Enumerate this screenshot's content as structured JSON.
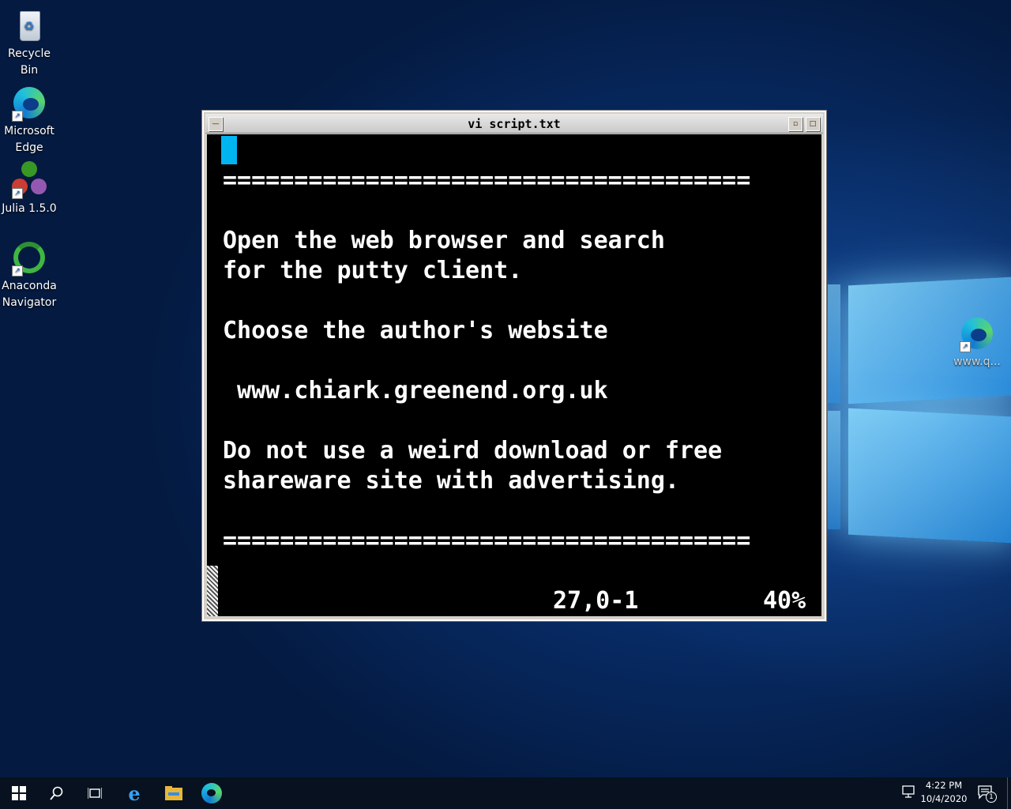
{
  "desktop": {
    "icons": [
      {
        "label": "Recycle\nBin",
        "icon": "recycle-bin-icon"
      },
      {
        "label": "Microsoft\nEdge",
        "icon": "edge-icon"
      },
      {
        "label": "Julia 1.5.0",
        "icon": "julia-icon"
      },
      {
        "label": "Anaconda\nNavigator",
        "icon": "anaconda-icon"
      },
      {
        "label": "www.q...",
        "icon": "edge-shortcut-icon"
      }
    ]
  },
  "window": {
    "title": "vi script.txt",
    "lines": [
      "=====================================",
      "Open the web browser and search",
      "for the putty client.",
      "Choose the author's website",
      " www.chiark.greenend.org.uk",
      "Do not use a weird download or free",
      "shareware site with advertising.",
      "====================================="
    ],
    "status_position": "27,0-1",
    "status_percent": "40%"
  },
  "taskbar": {
    "time": "4:22 PM",
    "date": "10/4/2020",
    "notifications_count": "1"
  },
  "colors": {
    "cursor": "#00b4f0",
    "terminal_bg": "#000000",
    "terminal_fg": "#ffffff"
  }
}
